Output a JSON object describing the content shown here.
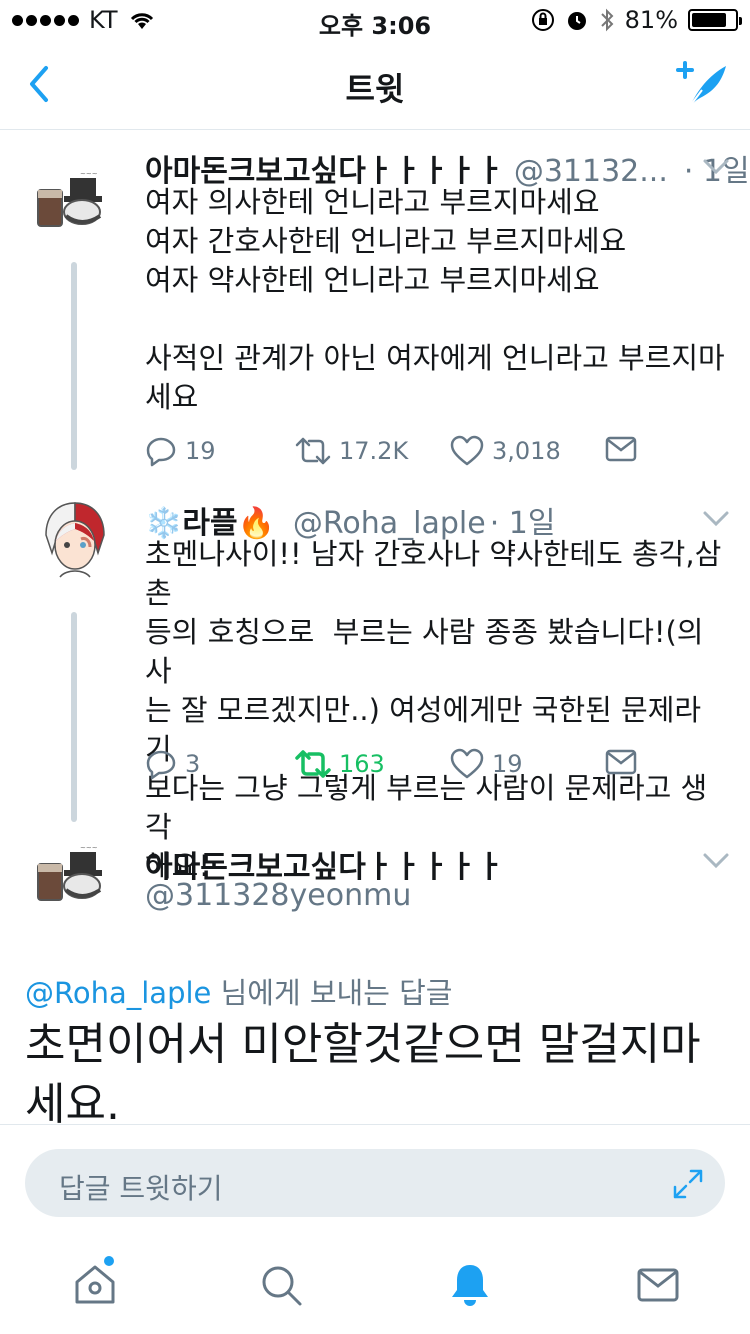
{
  "status_bar": {
    "carrier": "KT",
    "time": "오후 3:06",
    "battery": "81%",
    "battery_level": 0.81
  },
  "nav": {
    "title": "트윗",
    "back_icon": "chevron-left-icon",
    "compose_icon": "compose-feather-icon"
  },
  "tweets": [
    {
      "name": "아마돈크보고싶다ㅏㅏㅏㅏㅏ",
      "handle": "@31132...",
      "time": "· 1일",
      "text": "여자 의사한테 언니라고 부르지마세요\n여자 간호사한테 언니라고 부르지마세요\n여자 약사한테 언니라고 부르지마세요\n\n사적인 관계가 아닌 여자에게 언니라고 부르지마\n세요",
      "replies": "19",
      "retweets": "17.2K",
      "likes": "3,018"
    },
    {
      "name": "❄️라플🔥",
      "handle": "@Roha_laple",
      "time": "· 1일",
      "text": "초멘나사이!! 남자 간호사나 약사한테도 총각,삼촌\n등의 호칭으로  부르는 사람 종종 봤습니다!(의사\n는 잘 모르겠지만..) 여성에게만 국한된 문제라기\n보다는 그냥 그렇게 부르는 사람이 문제라고 생각\n해요!",
      "replies": "3",
      "retweets": "163",
      "likes": "19"
    }
  ],
  "focused_tweet": {
    "name": "아마돈크보고싶다ㅏㅏㅏㅏㅏ",
    "handle": "@311328yeonmu",
    "reply_to_mention": "@Roha_laple",
    "reply_to_suffix": " 님에게 보내는 답글",
    "text": "초면이어서 미안할것같으면 말걸지마세요."
  },
  "reply_bar": {
    "placeholder": "답글 트윗하기"
  },
  "tabs": [
    "home-icon",
    "search-icon",
    "notifications-icon",
    "messages-icon"
  ],
  "colors": {
    "accent": "#1da1f2",
    "retweet_active": "#17bf63",
    "secondary_text": "#657786"
  }
}
